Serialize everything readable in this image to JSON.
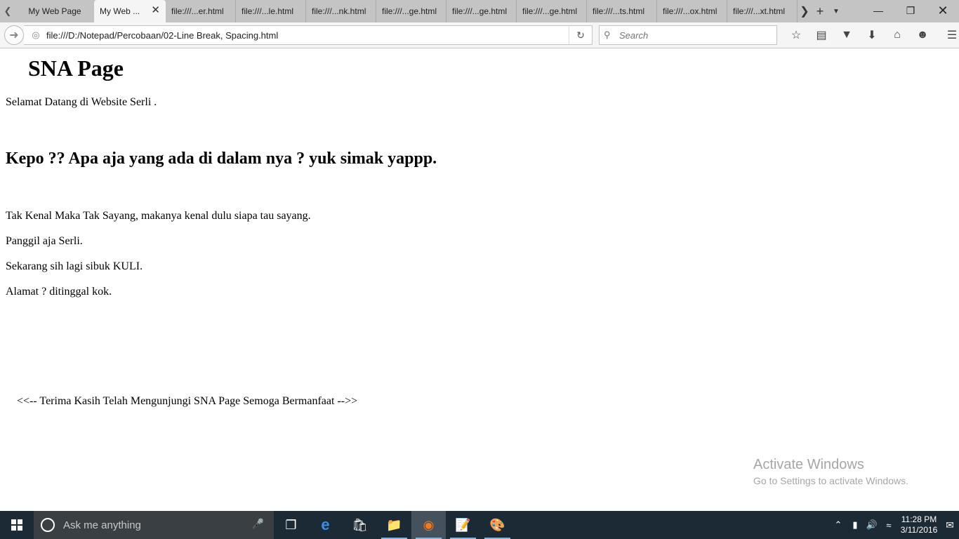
{
  "tabs": [
    {
      "label": "My Web Page",
      "active": false
    },
    {
      "label": "My Web ...",
      "active": true
    },
    {
      "label": "file:///...er.html",
      "active": false
    },
    {
      "label": "file:///...le.html",
      "active": false
    },
    {
      "label": "file:///...nk.html",
      "active": false
    },
    {
      "label": "file:///...ge.html",
      "active": false
    },
    {
      "label": "file:///...ge.html",
      "active": false
    },
    {
      "label": "file:///...ge.html",
      "active": false
    },
    {
      "label": "file:///...ts.html",
      "active": false
    },
    {
      "label": "file:///...ox.html",
      "active": false
    },
    {
      "label": "file:///...xt.html",
      "active": false
    }
  ],
  "tab_close_glyph": "✕",
  "url": "file:///D:/Notepad/Percobaan/02-Line Break, Spacing.html",
  "search": {
    "placeholder": "Search"
  },
  "page": {
    "heading": "SNA Page",
    "welcome": "Selamat Datang di Website Serli .",
    "subheading": "Kepo ?? Apa aja yang ada di dalam nya ? yuk simak yappp.",
    "paragraphs": [
      "Tak Kenal Maka Tak Sayang, makanya kenal dulu siapa tau sayang.",
      "Panggil aja Serli.",
      "Sekarang sih lagi sibuk KULI.",
      "Alamat ? ditinggal kok."
    ],
    "footer": "<<-- Terima Kasih Telah Mengunjungi SNA Page Semoga Bermanfaat -->>"
  },
  "watermark": {
    "title": "Activate Windows",
    "subtitle": "Go to Settings to activate Windows."
  },
  "taskbar": {
    "search_placeholder": "Ask me anything",
    "time": "11:28 PM",
    "date": "3/11/2016"
  },
  "icons": [
    "back-icon",
    "globe-icon",
    "reload-icon",
    "search-icon",
    "star-icon",
    "reading-list-icon",
    "pocket-icon",
    "download-icon",
    "home-icon",
    "feedback-icon",
    "menu-icon",
    "windows-start-icon",
    "cortana-icon",
    "microphone-icon",
    "task-view-icon",
    "edge-icon",
    "store-icon",
    "file-explorer-icon",
    "firefox-icon",
    "notepad-icon",
    "paint-icon",
    "chevron-up-icon",
    "battery-icon",
    "volume-icon",
    "network-icon",
    "action-center-icon"
  ]
}
